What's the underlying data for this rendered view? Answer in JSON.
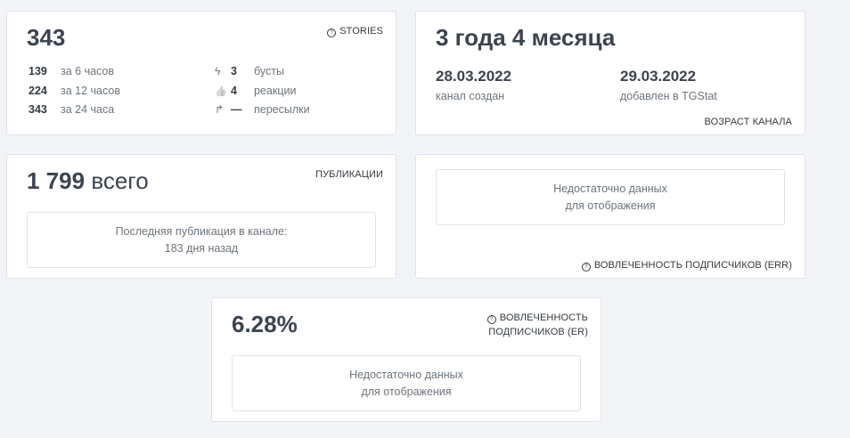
{
  "stories_card": {
    "total": "343",
    "tag": "STORIES",
    "rows": [
      {
        "value": "139",
        "label": "за 6 часов"
      },
      {
        "value": "224",
        "label": "за 12 часов"
      },
      {
        "value": "343",
        "label": "за 24 часа"
      }
    ],
    "stats": [
      {
        "icon": "lightning-icon",
        "glyph": "ϟ",
        "value": "3",
        "label": "бусты"
      },
      {
        "icon": "thumbs-up-icon",
        "glyph": "👍",
        "value": "4",
        "label": "реакции"
      },
      {
        "icon": "forward-icon",
        "glyph": "↱",
        "value": "—",
        "label": "пересылки"
      }
    ]
  },
  "age_card": {
    "title": "3 года 4 месяца",
    "created_date": "28.03.2022",
    "created_label": "канал создан",
    "added_date": "29.03.2022",
    "added_label": "добавлен в TGStat",
    "tag": "ВОЗРАСТ КАНАЛА"
  },
  "publications_card": {
    "total_number": "1 799",
    "total_suffix": "всего",
    "tag": "ПУБЛИКАЦИИ",
    "last_line1": "Последняя публикация в канале:",
    "last_line2": "183 дня назад"
  },
  "err_card": {
    "line1": "Недостаточно данных",
    "line2": "для отображения",
    "tag": "ВОВЛЕЧЕННОСТЬ ПОДПИСЧИКОВ (ERR)"
  },
  "er_card": {
    "value": "6.28%",
    "tag_line1": "ВОВЛЕЧЕННОСТЬ",
    "tag_line2": "ПОДПИСЧИКОВ (ER)",
    "line1": "Недостаточно данных",
    "line2": "для отображения"
  }
}
